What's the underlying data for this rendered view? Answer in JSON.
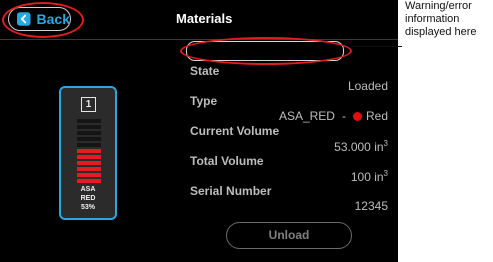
{
  "header": {
    "back_label": "Back",
    "title": "Materials"
  },
  "message_field": {
    "value": ""
  },
  "spool": {
    "slot": "1",
    "material": "ASA",
    "color_name": "RED",
    "percent": "53%",
    "fill_fraction": 0.53,
    "segments_total": 11,
    "segments_filled": 6,
    "gauge_color": "#e31b23"
  },
  "details": {
    "state_label": "State",
    "state_value": "Loaded",
    "type_label": "Type",
    "type_material": "ASA_RED",
    "type_separator": "-",
    "type_color": "Red",
    "type_color_hex": "#e01010",
    "current_volume_label": "Current Volume",
    "current_volume_value": "53.000 in",
    "total_volume_label": "Total Volume",
    "total_volume_value": "100 in",
    "volume_unit_exp": "3",
    "serial_label": "Serial Number",
    "serial_value": "12345"
  },
  "actions": {
    "unload_label": "Unload"
  },
  "annotation": {
    "text": "Warning/error information displayed here"
  },
  "colors": {
    "accent": "#29a8e0",
    "highlight": "#e11d1d",
    "background": "#000000"
  }
}
